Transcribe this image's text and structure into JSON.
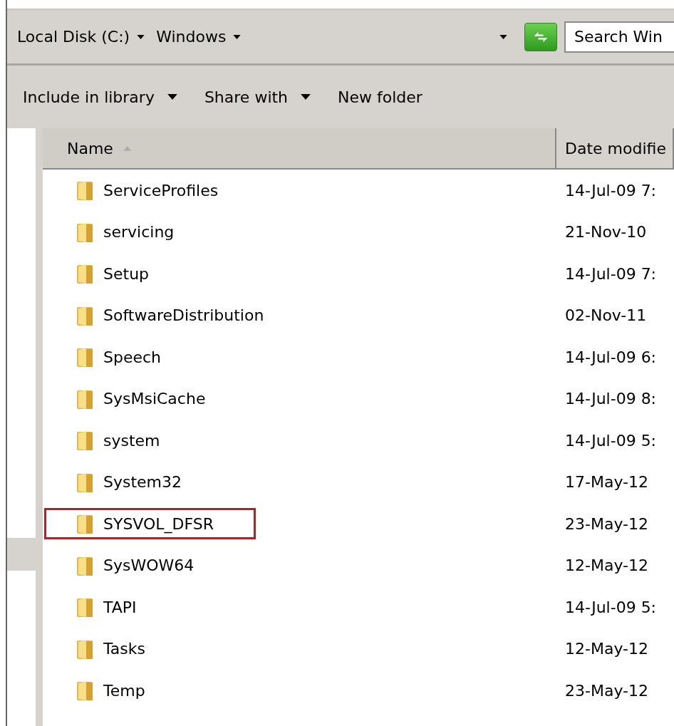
{
  "address_bar": {
    "breadcrumbs": [
      {
        "label": "Local Disk (C:)"
      },
      {
        "label": "Windows"
      }
    ],
    "search": {
      "placeholder": "Search Win"
    }
  },
  "toolbar": {
    "buttons": [
      {
        "label": "Include in library",
        "dropdown": true
      },
      {
        "label": "Share with",
        "dropdown": true
      },
      {
        "label": "New folder",
        "dropdown": false
      }
    ]
  },
  "navigation_pane": {
    "items": [
      {
        "selected": true
      }
    ]
  },
  "file_list": {
    "columns": [
      {
        "label": "Name",
        "sorted": true
      },
      {
        "label": "Date modifie",
        "sorted": false
      }
    ],
    "rows": [
      {
        "name": "ServiceProfiles",
        "date": "14-Jul-09 7:",
        "highlighted": false
      },
      {
        "name": "servicing",
        "date": "21-Nov-10",
        "highlighted": false
      },
      {
        "name": "Setup",
        "date": "14-Jul-09 7:",
        "highlighted": false
      },
      {
        "name": "SoftwareDistribution",
        "date": "02-Nov-11",
        "highlighted": false
      },
      {
        "name": "Speech",
        "date": "14-Jul-09 6:",
        "highlighted": false
      },
      {
        "name": "SysMsiCache",
        "date": "14-Jul-09 8:",
        "highlighted": false
      },
      {
        "name": "system",
        "date": "14-Jul-09 5:",
        "highlighted": false
      },
      {
        "name": "System32",
        "date": "17-May-12",
        "highlighted": false
      },
      {
        "name": "SYSVOL_DFSR",
        "date": "23-May-12",
        "highlighted": true
      },
      {
        "name": "SysWOW64",
        "date": "12-May-12",
        "highlighted": false
      },
      {
        "name": "TAPI",
        "date": "14-Jul-09 5:",
        "highlighted": false
      },
      {
        "name": "Tasks",
        "date": "12-May-12",
        "highlighted": false
      },
      {
        "name": "Temp",
        "date": "23-May-12",
        "highlighted": false
      }
    ]
  }
}
